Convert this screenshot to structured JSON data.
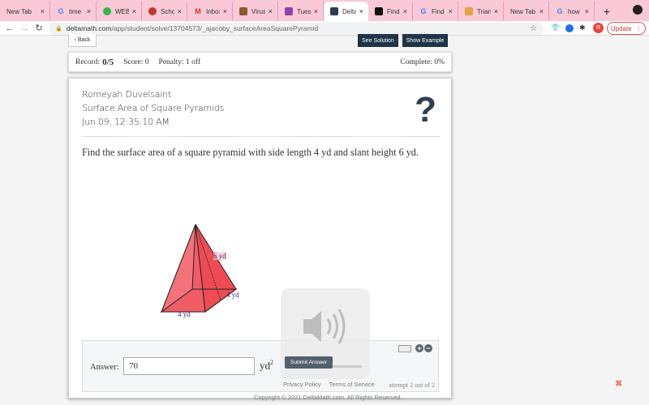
{
  "browser": {
    "tabs": [
      {
        "label": "New Tab",
        "icon": "none",
        "color": "#f9c9d8"
      },
      {
        "label": "time -",
        "icon": "google-icon",
        "color": "#4285f4"
      },
      {
        "label": "WEBT",
        "icon": "green-blob-icon",
        "color": "#3cb44b"
      },
      {
        "label": "Schoo",
        "icon": "school-icon",
        "color": "#c0392b"
      },
      {
        "label": "Inbox",
        "icon": "gmail-icon",
        "color": "#d93025"
      },
      {
        "label": "Viruse",
        "icon": "image-icon",
        "color": "#8a5a2b"
      },
      {
        "label": "Tuesd",
        "icon": "calendar-icon",
        "color": "#8e44ad"
      },
      {
        "label": "Delta",
        "icon": "deltamath-icon",
        "color": "#2c3e50",
        "active": true
      },
      {
        "label": "Find th",
        "icon": "book-icon",
        "color": "#111111"
      },
      {
        "label": "Find th",
        "icon": "google-icon",
        "color": "#4285f4"
      },
      {
        "label": "Triang",
        "icon": "cube-icon",
        "color": "#e6a23c"
      },
      {
        "label": "New Tab",
        "icon": "none",
        "color": "#f9c9d8"
      },
      {
        "label": "how to",
        "icon": "google-icon",
        "color": "#4285f4"
      }
    ],
    "close_glyph": "×",
    "new_tab_glyph": "+",
    "url_domain": "deltamath.com",
    "url_path": "/app/student/solve/13704573/_ajacoby_surfaceAreaSquarePyramid",
    "avatar_letter": "R",
    "update_label": "Update",
    "update_menu": "⋮"
  },
  "nav": {
    "back_label": "‹ Back",
    "see_solution": "See Solution",
    "show_example": "Show Example"
  },
  "record": {
    "record_label": "Record:",
    "record_value": "0/5",
    "score": "Score: 0",
    "penalty": "Penalty: 1 off",
    "complete": "Complete: 0%"
  },
  "problem": {
    "student_name": "Romeyah Duvelsaint",
    "topic": "Surface Area of Square Pyramids",
    "timestamp": "Jun 09, 12:35:10 AM",
    "help_glyph": "?",
    "question": "Find the surface area of a square pyramid with side length 4 yd and slant height 6 yd.",
    "figure": {
      "slant_label": "6 yd",
      "side_label_right": "4 yd",
      "side_label_bottom": "4 yd",
      "fill_color": "#f0656b"
    }
  },
  "answer": {
    "label": "Answer:",
    "value": "70",
    "unit": "yd",
    "unit_exp": "2",
    "submit_label": "Submit Answer",
    "attempt": "attempt 2 out of 2",
    "plus": "+",
    "minus": "−"
  },
  "footer": {
    "privacy": "Privacy Policy",
    "terms": "Terms of Service",
    "copyright": "Copyright © 2021 DeltaMath.com. All Rights Reserved.",
    "close_glyph": "✖"
  }
}
